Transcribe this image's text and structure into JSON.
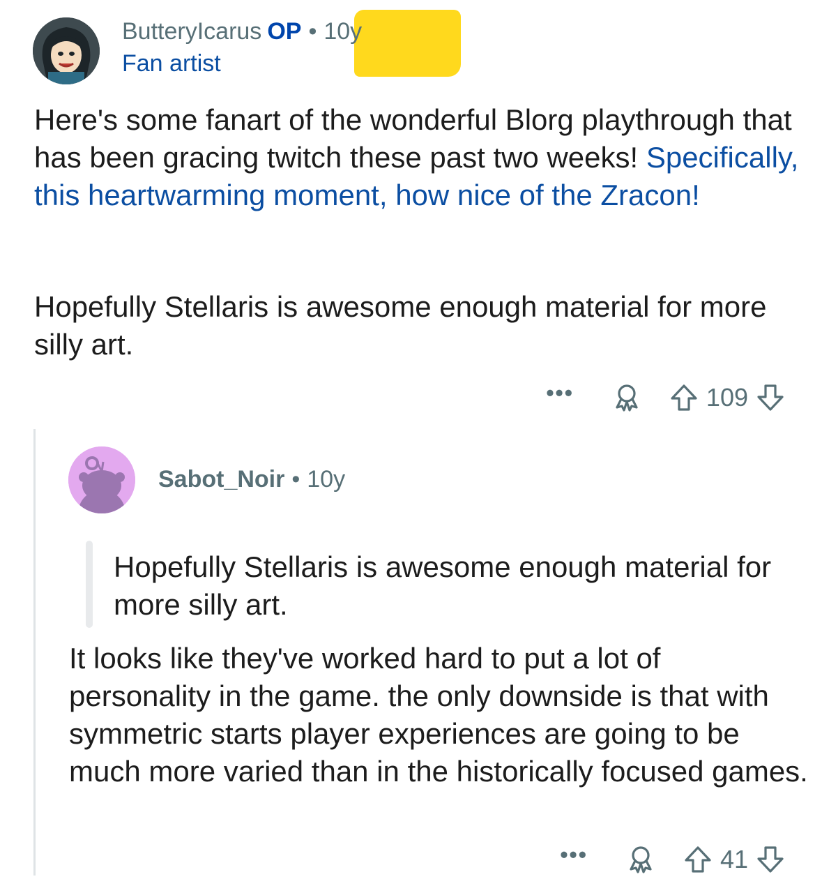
{
  "comment": {
    "author": "ButteryIcarus",
    "op_badge": "OP",
    "separator": "•",
    "age": "10y",
    "flair": "Fan artist",
    "body_plain": "Here's some fanart of the wonderful Blorg playthrough that has been gracing twitch these past two weeks! ",
    "body_link": "Specifically, this heartwarming moment, how nice of the Zracon!",
    "body_second": "Hopefully Stellaris is awesome enough material for more silly art.",
    "more_label": "•••",
    "vote_count": "109"
  },
  "reply": {
    "author": "Sabot_Noir",
    "separator": "•",
    "age": "10y",
    "quote": "Hopefully Stellaris is awesome enough material for more silly art.",
    "body": "It looks like they've worked hard to put a lot of personality in the game. the only downside is that with symmetric starts player experiences are going to be much more varied than in the historically focused games.",
    "more_label": "•••",
    "vote_count": "41"
  },
  "colors": {
    "meta_gray": "#576f76",
    "link_blue": "#0b4ea2",
    "op_blue": "#0045ac",
    "highlight_yellow": "#ffd60a",
    "reply_avatar_bg": "#e6a8f0"
  },
  "icons": [
    "user-avatar",
    "snoo-avatar",
    "more-options-icon",
    "award-icon",
    "upvote-arrow-icon",
    "downvote-arrow-icon"
  ]
}
